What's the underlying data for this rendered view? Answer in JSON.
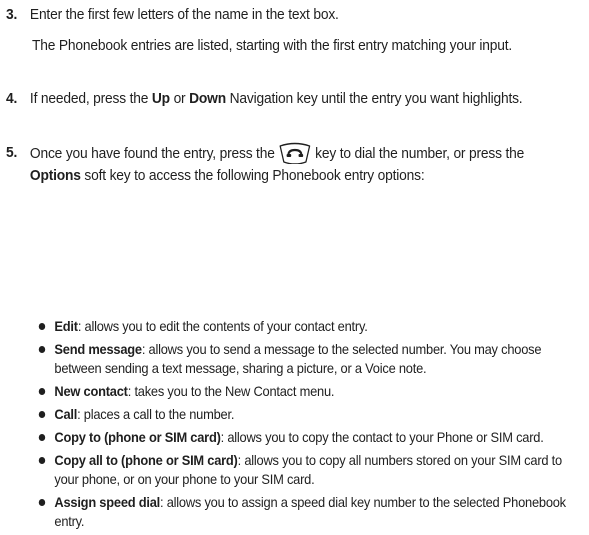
{
  "steps": [
    {
      "number": "3.",
      "text": "Enter the first few letters of the name in the text box.",
      "detail": "The Phonebook entries are listed, starting with the first entry matching your input."
    },
    {
      "number": "4.",
      "pre": "If needed, press the ",
      "up": "Up",
      "or": " or ",
      "down": "Down",
      "post": " Navigation key until the entry you want highlights."
    },
    {
      "number": "5.",
      "pre": "Once you have found the entry, press the",
      "mid": "key to dial the number, or press the ",
      "options": "Options",
      "post": " soft key to access the following Phonebook entry options:",
      "key_icon": "send-key-icon"
    }
  ],
  "bullets": [
    {
      "term": "Edit",
      "desc": ": allows you to edit the contents of your contact entry."
    },
    {
      "term": "Send message",
      "desc": ": allows you to send a message to the selected number. You may choose between sending a text message, sharing a picture, or a Voice note."
    },
    {
      "term": "New contact",
      "desc": ": takes you to the New Contact menu."
    },
    {
      "term": "Call",
      "desc": ": places a call to the number."
    },
    {
      "term": "Copy to (phone or SIM card)",
      "desc": ": allows you to copy the contact to your Phone or SIM card."
    },
    {
      "term": "Copy all to (phone or SIM card)",
      "desc": ": allows you to copy all numbers stored on your SIM card to your phone, or on your phone to your SIM card."
    },
    {
      "term": "Assign speed dial",
      "desc": ": allows you to assign a speed dial key number to the selected Phonebook entry."
    }
  ]
}
